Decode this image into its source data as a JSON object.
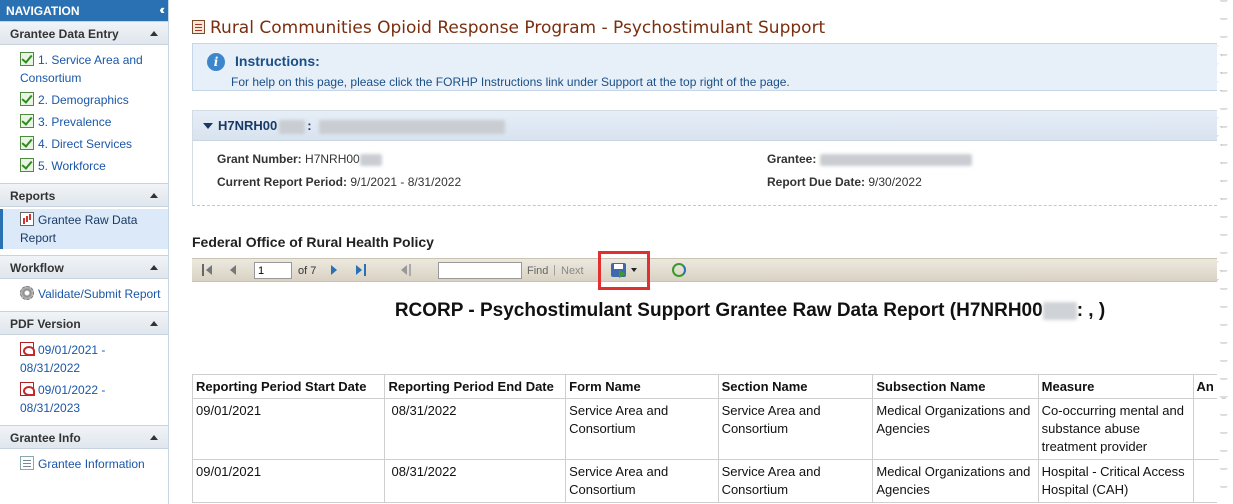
{
  "sidebar": {
    "header": "NAVIGATION",
    "collapse_icon": "double-chevron-left-icon",
    "sections": [
      {
        "title": "Grantee Data Entry",
        "items": [
          {
            "label": "1. Service Area and Consortium",
            "icon": "check-icon"
          },
          {
            "label": "2. Demographics",
            "icon": "check-icon"
          },
          {
            "label": "3. Prevalence",
            "icon": "check-icon"
          },
          {
            "label": "4. Direct Services",
            "icon": "check-icon"
          },
          {
            "label": "5. Workforce",
            "icon": "check-icon"
          }
        ]
      },
      {
        "title": "Reports",
        "items": [
          {
            "label": "Grantee Raw Data Report",
            "icon": "report-icon",
            "active": true
          }
        ]
      },
      {
        "title": "Workflow",
        "items": [
          {
            "label": "Validate/Submit Report",
            "icon": "gear-icon"
          }
        ]
      },
      {
        "title": "PDF Version",
        "items": [
          {
            "label": "09/01/2021 - 08/31/2022",
            "icon": "pdf-icon"
          },
          {
            "label": "09/01/2022 - 08/31/2023",
            "icon": "pdf-icon"
          }
        ]
      },
      {
        "title": "Grantee Info",
        "items": [
          {
            "label": "Grantee Information",
            "icon": "info-icon"
          }
        ]
      }
    ]
  },
  "main": {
    "page_title": "Rural Communities Opioid Response Program - Psychostimulant Support",
    "instructions": {
      "title": "Instructions:",
      "text": "For help on this page, please click the FORHP Instructions link under Support at the top right of the page."
    },
    "grant": {
      "header_id": "H7NRH00",
      "header_sep": ":",
      "grant_number_label": "Grant Number:",
      "grant_number_value": "H7NRH00",
      "report_period_label": "Current Report Period:",
      "report_period_value": "9/1/2021 - 8/31/2022",
      "grantee_label": "Grantee:",
      "due_date_label": "Report Due Date:",
      "due_date_value": "9/30/2022"
    },
    "office_title": "Federal Office of Rural Health Policy",
    "toolbar": {
      "page_value": "1",
      "of_pages": "of 7",
      "find_label": "Find",
      "find_sep": "|",
      "next_label": "Next"
    },
    "report_title_prefix": "RCORP - Psychostimulant Support Grantee Raw Data Report (H7NRH00",
    "report_title_suffix": ": , )",
    "table": {
      "headers": [
        "Reporting Period Start Date",
        "Reporting Period End Date",
        "Form Name",
        "Section Name",
        "Subsection Name",
        "Measure",
        "An"
      ],
      "rows": [
        [
          "09/01/2021",
          "08/31/2022",
          "Service Area and Consortium",
          "Service Area and Consortium",
          "Medical Organizations and Agencies",
          "Co-occurring mental and substance abuse treatment provider",
          ""
        ],
        [
          "09/01/2021",
          "08/31/2022",
          "Service Area and Consortium",
          "Service Area and Consortium",
          "Medical Organizations and Agencies",
          "Hospital - Critical Access Hospital (CAH)",
          ""
        ]
      ]
    }
  }
}
